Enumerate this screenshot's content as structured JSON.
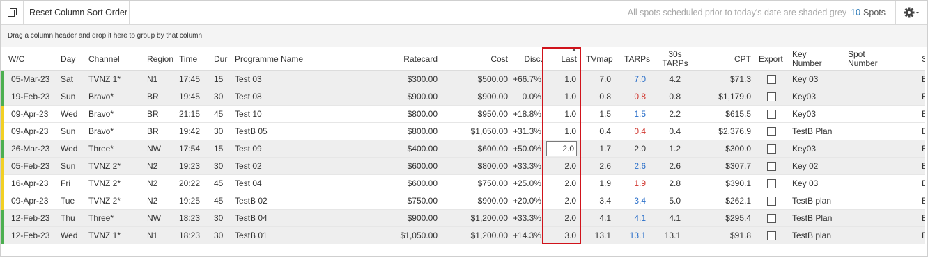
{
  "toolbar": {
    "copy_icon": "copy-icon",
    "reset_label": "Reset Column Sort Order",
    "info_text": "All spots scheduled prior to today's date are shaded grey",
    "spot_count": "10",
    "spots_label": "Spots",
    "gear_icon": "gear-icon"
  },
  "group_panel": {
    "text": "Drag a column header and drop it here to group by that column"
  },
  "colors": {
    "green": "#4caf50",
    "yellow": "#f2d024",
    "highlight": "#d0131b",
    "blue": "#2a6fc9",
    "red": "#d0342c"
  },
  "columns": {
    "wc": "W/C",
    "day": "Day",
    "channel": "Channel",
    "region": "Region",
    "time": "Time",
    "dur": "Dur",
    "programme": "Programme Name",
    "ratecard": "Ratecard",
    "cost": "Cost",
    "disc": "Disc.",
    "last": "Last",
    "tvmap": "TVmap",
    "tarps": "TARPs",
    "tarps30": "30s TARPs",
    "cpt": "CPT",
    "export": "Export",
    "key": "Key Number",
    "spot": "Spot Number",
    "s_partial": "S"
  },
  "rows": [
    {
      "wc": "05-Mar-23",
      "day": "Sat",
      "channel": "TVNZ 1*",
      "region": "N1",
      "time": "17:45",
      "dur": "15",
      "programme": "Test 03",
      "ratecard": "$300.00",
      "cost": "$500.00",
      "disc": "+66.7%",
      "last": "1.0",
      "tvmap": "7.0",
      "tarps": "7.0",
      "tarps_color": "blue",
      "tarps30": "4.2",
      "cpt": "$71.3",
      "key": "Key 03",
      "spot": "",
      "s_partial": "B",
      "bar": "green",
      "shade": "grey"
    },
    {
      "wc": "19-Feb-23",
      "day": "Sun",
      "channel": "Bravo*",
      "region": "BR",
      "time": "19:45",
      "dur": "30",
      "programme": "Test 08",
      "ratecard": "$900.00",
      "cost": "$900.00",
      "disc": "0.0%",
      "last": "1.0",
      "tvmap": "0.8",
      "tarps": "0.8",
      "tarps_color": "red",
      "tarps30": "0.8",
      "cpt": "$1,179.0",
      "key": "Key03",
      "spot": "",
      "s_partial": "B",
      "bar": "green",
      "shade": "grey"
    },
    {
      "wc": "09-Apr-23",
      "day": "Wed",
      "channel": "Bravo*",
      "region": "BR",
      "time": "21:15",
      "dur": "45",
      "programme": "Test 10",
      "ratecard": "$800.00",
      "cost": "$950.00",
      "disc": "+18.8%",
      "last": "1.0",
      "tvmap": "1.5",
      "tarps": "1.5",
      "tarps_color": "blue",
      "tarps30": "2.2",
      "cpt": "$615.5",
      "key": "Key03",
      "spot": "",
      "s_partial": "B",
      "bar": "yellow",
      "shade": "white"
    },
    {
      "wc": "09-Apr-23",
      "day": "Sun",
      "channel": "Bravo*",
      "region": "BR",
      "time": "19:42",
      "dur": "30",
      "programme": "TestB 05",
      "ratecard": "$800.00",
      "cost": "$1,050.00",
      "disc": "+31.3%",
      "last": "1.0",
      "tvmap": "0.4",
      "tarps": "0.4",
      "tarps_color": "red",
      "tarps30": "0.4",
      "cpt": "$2,376.9",
      "key": "TestB Plan",
      "spot": "",
      "s_partial": "B",
      "bar": "yellow",
      "shade": "white"
    },
    {
      "wc": "26-Mar-23",
      "day": "Wed",
      "channel": "Three*",
      "region": "NW",
      "time": "17:54",
      "dur": "15",
      "programme": "Test 09",
      "ratecard": "$400.00",
      "cost": "$600.00",
      "disc": "+50.0%",
      "last": "2.0",
      "tvmap": "1.7",
      "tarps": "2.0",
      "tarps_color": "",
      "tarps30": "1.2",
      "cpt": "$300.0",
      "key": "Key03",
      "spot": "",
      "s_partial": "B",
      "bar": "green",
      "shade": "grey",
      "editing": true
    },
    {
      "wc": "05-Feb-23",
      "day": "Sun",
      "channel": "TVNZ 2*",
      "region": "N2",
      "time": "19:23",
      "dur": "30",
      "programme": "Test 02",
      "ratecard": "$600.00",
      "cost": "$800.00",
      "disc": "+33.3%",
      "last": "2.0",
      "tvmap": "2.6",
      "tarps": "2.6",
      "tarps_color": "blue",
      "tarps30": "2.6",
      "cpt": "$307.7",
      "key": "Key 02",
      "spot": "",
      "s_partial": "B",
      "bar": "yellow",
      "shade": "grey"
    },
    {
      "wc": "16-Apr-23",
      "day": "Fri",
      "channel": "TVNZ 2*",
      "region": "N2",
      "time": "20:22",
      "dur": "45",
      "programme": "Test 04",
      "ratecard": "$600.00",
      "cost": "$750.00",
      "disc": "+25.0%",
      "last": "2.0",
      "tvmap": "1.9",
      "tarps": "1.9",
      "tarps_color": "red",
      "tarps30": "2.8",
      "cpt": "$390.1",
      "key": "Key 03",
      "spot": "",
      "s_partial": "B",
      "bar": "yellow",
      "shade": "white"
    },
    {
      "wc": "09-Apr-23",
      "day": "Tue",
      "channel": "TVNZ 2*",
      "region": "N2",
      "time": "19:25",
      "dur": "45",
      "programme": "TestB 02",
      "ratecard": "$750.00",
      "cost": "$900.00",
      "disc": "+20.0%",
      "last": "2.0",
      "tvmap": "3.4",
      "tarps": "3.4",
      "tarps_color": "blue",
      "tarps30": "5.0",
      "cpt": "$262.1",
      "key": "TestB plan",
      "spot": "",
      "s_partial": "B",
      "bar": "yellow",
      "shade": "white"
    },
    {
      "wc": "12-Feb-23",
      "day": "Thu",
      "channel": "Three*",
      "region": "NW",
      "time": "18:23",
      "dur": "30",
      "programme": "TestB 04",
      "ratecard": "$900.00",
      "cost": "$1,200.00",
      "disc": "+33.3%",
      "last": "2.0",
      "tvmap": "4.1",
      "tarps": "4.1",
      "tarps_color": "blue",
      "tarps30": "4.1",
      "cpt": "$295.4",
      "key": "TestB Plan",
      "spot": "",
      "s_partial": "B",
      "bar": "green",
      "shade": "grey"
    },
    {
      "wc": "12-Feb-23",
      "day": "Wed",
      "channel": "TVNZ 1*",
      "region": "N1",
      "time": "18:23",
      "dur": "30",
      "programme": "TestB 01",
      "ratecard": "$1,050.00",
      "cost": "$1,200.00",
      "disc": "+14.3%",
      "last": "3.0",
      "tvmap": "13.1",
      "tarps": "13.1",
      "tarps_color": "blue",
      "tarps30": "13.1",
      "cpt": "$91.8",
      "key": "TestB plan",
      "spot": "",
      "s_partial": "B",
      "bar": "green",
      "shade": "grey"
    }
  ]
}
